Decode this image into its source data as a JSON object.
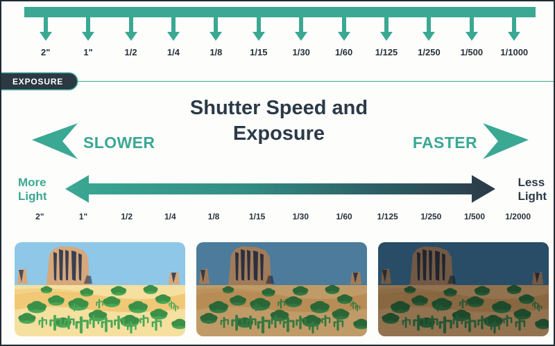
{
  "theme": {
    "teal": "#3aa893",
    "navy": "#2b3a47",
    "dark_pill": "#2c3943",
    "page_bg": "#fdfdfc",
    "text_dark": "#27313a"
  },
  "top_scale": {
    "name": "shutter-speed-scale-top",
    "bar_color": "#3aa893",
    "labels": [
      "2\"",
      "1\"",
      "1/2",
      "1/4",
      "1/8",
      "1/15",
      "1/30",
      "1/60",
      "1/125",
      "1/250",
      "1/500",
      "1/1000"
    ]
  },
  "exposure_tag": {
    "label": "EXPOSURE"
  },
  "title": {
    "line1": "Shutter Speed and",
    "line2": "Exposure",
    "full": "Shutter Speed and Exposure"
  },
  "direction": {
    "slower_label": "SLOWER",
    "faster_label": "FASTER",
    "slower_icon": "arrow-left-icon",
    "faster_icon": "arrow-right-icon"
  },
  "light_axis": {
    "more_light_line1": "More",
    "more_light_line2": "Light",
    "less_light_line1": "Less",
    "less_light_line2": "Light",
    "gradient_start": "#3aa893",
    "gradient_end": "#2b3a47"
  },
  "bottom_scale": {
    "name": "shutter-speed-scale-bottom",
    "labels": [
      "2\"",
      "1\"",
      "1/2",
      "1/4",
      "1/8",
      "1/15",
      "1/30",
      "1/60",
      "1/125",
      "1/250",
      "1/500",
      "1/2000"
    ]
  },
  "photos": [
    {
      "name": "desert-photo-bright",
      "exposure": "slow shutter / bright",
      "dim": 0.0,
      "sky": "#8ec7e8",
      "sand": "#f5e0a0",
      "sand_mid": "#f0c46e",
      "rock": "#d6a87c",
      "rock_dark": "#1f2d4a",
      "cactus": "#4aa856",
      "bush": "#3c8f46"
    },
    {
      "name": "desert-photo-medium",
      "exposure": "medium shutter / balanced",
      "dim": 0.18,
      "sky": "#5b93b8",
      "sand": "#e8ba78",
      "sand_mid": "#dca45e",
      "rock": "#c1936a",
      "rock_dark": "#1b2740",
      "cactus": "#3f8f4a",
      "bush": "#33793c"
    },
    {
      "name": "desert-photo-dark",
      "exposure": "fast shutter / dark",
      "dim": 0.34,
      "sky": "#3b6d8e",
      "sand": "#d9a46a",
      "sand_mid": "#c8904f",
      "rock": "#a87f5c",
      "rock_dark": "#16202f",
      "cactus": "#357a3f",
      "bush": "#2a6632"
    }
  ]
}
